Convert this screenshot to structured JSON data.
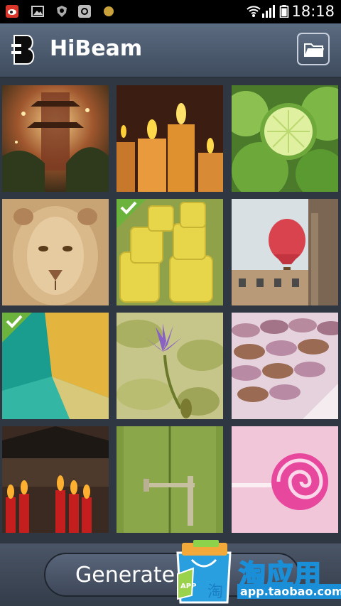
{
  "status_bar": {
    "time": "18:18",
    "icons": [
      "weibo-icon",
      "gallery-icon",
      "shield-icon",
      "sync-icon",
      "coin-icon",
      "wifi-icon",
      "signal-icon",
      "battery-icon"
    ]
  },
  "app_bar": {
    "title": "HiBeam",
    "folder_button_icon": "folder-icon"
  },
  "gallery": {
    "items": [
      {
        "subject": "temple-lights",
        "selected": false
      },
      {
        "subject": "candles",
        "selected": false
      },
      {
        "subject": "limes",
        "selected": false
      },
      {
        "subject": "lion",
        "selected": false
      },
      {
        "subject": "yellow-glasses",
        "selected": true
      },
      {
        "subject": "hot-air-balloon",
        "selected": false
      },
      {
        "subject": "abstract-teal-yellow",
        "selected": true
      },
      {
        "subject": "water-lily",
        "selected": false
      },
      {
        "subject": "macarons",
        "selected": false
      },
      {
        "subject": "red-candles-temple",
        "selected": false
      },
      {
        "subject": "green-door",
        "selected": false
      },
      {
        "subject": "lollipop",
        "selected": false
      }
    ]
  },
  "bottom_bar": {
    "generate_label": "Generate"
  },
  "watermark": {
    "brand": "淘应用",
    "url": "app.taobao.com",
    "bag_label": "APP",
    "bag_char": "淘"
  },
  "colors": {
    "app_bar": "#4e5d71",
    "grid_bg": "#2f3743",
    "selected_check": "#6cb33e",
    "watermark_blue": "#1a8fd8"
  }
}
